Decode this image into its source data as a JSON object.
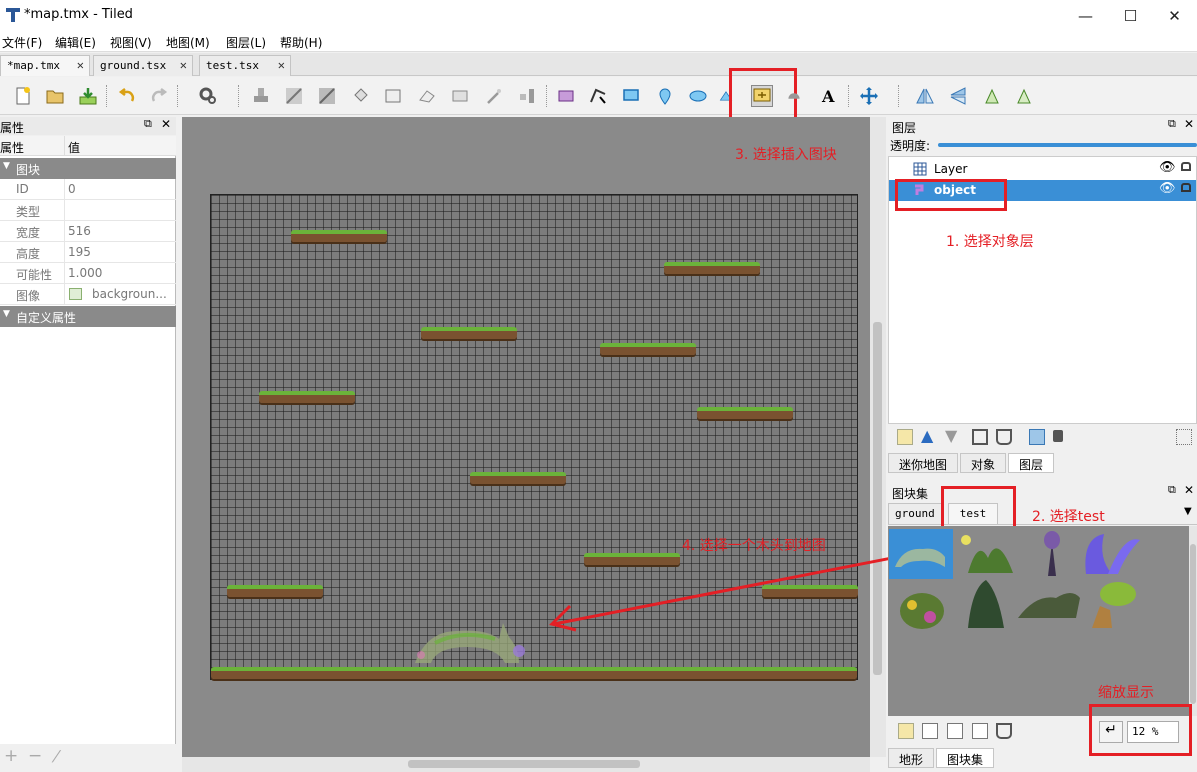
{
  "window": {
    "title": "*map.tmx - Tiled",
    "minimize": "—",
    "maximize": "☐",
    "close": "✕"
  },
  "menu": [
    "文件(F)",
    "编辑(E)",
    "视图(V)",
    "地图(M)",
    "图层(L)",
    "帮助(H)"
  ],
  "tabs": [
    {
      "label": "*map.tmx",
      "close": "✕"
    },
    {
      "label": "ground.tsx",
      "close": "✕"
    },
    {
      "label": "test.tsx",
      "close": "✕"
    }
  ],
  "properties": {
    "title": "属性",
    "col_name": "属性",
    "col_value": "值",
    "group_tile": "图块",
    "rows": [
      {
        "key": "ID",
        "value": "0"
      },
      {
        "key": "类型",
        "value": ""
      },
      {
        "key": "宽度",
        "value": "516"
      },
      {
        "key": "高度",
        "value": "195"
      },
      {
        "key": "可能性",
        "value": "1.000"
      },
      {
        "key": "图像",
        "value": "backgroun..."
      }
    ],
    "group_custom": "自定义属性",
    "footer": {
      "add": "+",
      "remove": "−",
      "edit": "/"
    }
  },
  "layers": {
    "title": "图层",
    "opacity_label": "透明度:",
    "opacity_fraction": 1.0,
    "items": [
      {
        "name": "Layer",
        "selected": false
      },
      {
        "name": "object",
        "selected": true
      }
    ],
    "tabs": [
      "迷你地图",
      "对象",
      "图层"
    ],
    "active_tab": "图层"
  },
  "tilesets": {
    "title": "图块集",
    "tabs": [
      "ground",
      "test"
    ],
    "active_tab": "test",
    "zoom": "12 %",
    "bottom_tabs": [
      "地形",
      "图块集"
    ],
    "active_bottom_tab": "图块集"
  },
  "annotations": {
    "step1": "1. 选择对象层",
    "step2": "2. 选择test",
    "step3": "3. 选择插入图块",
    "step4": "4. 选择一个木头到地图",
    "zoom_note": "缩放显示"
  },
  "colors": {
    "annotation_red": "#e41f25",
    "selection_blue": "#3a8fd6",
    "canvas_gray": "#8a8a8a",
    "grass_green": "#6bb33a",
    "dirt_brown": "#7a5230"
  }
}
